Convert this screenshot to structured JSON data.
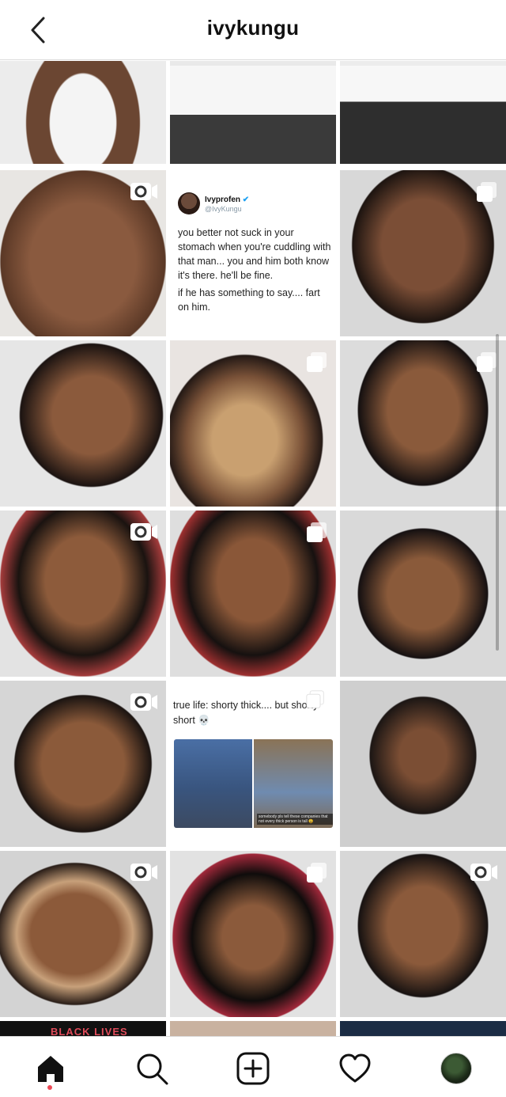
{
  "header": {
    "title": "ivykungu",
    "back_icon": "chevron-left-icon"
  },
  "grid": {
    "tweet_post": {
      "name": "Ivyprofen",
      "handle": "@IvyKungu",
      "text1": "you better not suck in your stomach when you're cuddling with that man... you and him both know it's there. he'll be fine.",
      "text2": "if he has something to say.... fart on him."
    },
    "tweet_post_2": {
      "caption": "true life: shorty thick.... but shorty short 💀",
      "image_caption": "somebody pls tell these companies that not every thick person is tall 😩"
    },
    "bottom_partial_text": "BLACK LIVES"
  },
  "nav": {
    "home_icon": "home-icon",
    "search_icon": "search-icon",
    "new_post_icon": "plus-square-icon",
    "activity_icon": "heart-icon",
    "profile_icon": "avatar"
  },
  "colors": {
    "notification_dot": "#ed4956",
    "verified": "#1da1f2",
    "border": "#dbdbdb"
  }
}
